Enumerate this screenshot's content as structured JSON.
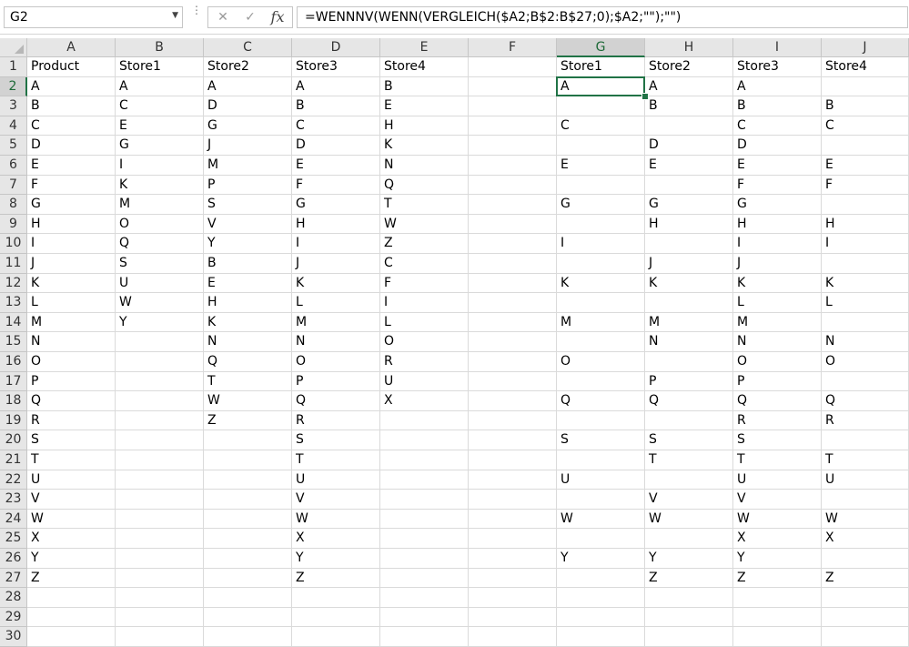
{
  "namebox": {
    "value": "G2"
  },
  "formula_bar": {
    "formula": "=WENNNV(WENN(VERGLEICH($A2;B$2:B$27;0);$A2;\"\");\"\")",
    "cancel_icon": "x-icon",
    "enter_icon": "checkmark-icon",
    "function_icon": "fx-icon"
  },
  "columns": [
    "A",
    "B",
    "C",
    "D",
    "E",
    "F",
    "G",
    "H",
    "I",
    "J"
  ],
  "rows": [
    "1",
    "2",
    "3",
    "4",
    "5",
    "6",
    "7",
    "8",
    "9",
    "10",
    "11",
    "12",
    "13",
    "14",
    "15",
    "16",
    "17",
    "18",
    "19",
    "20",
    "21",
    "22",
    "23",
    "24",
    "25",
    "26",
    "27",
    "28",
    "29",
    "30"
  ],
  "active_cell": {
    "col": "G",
    "row": "2"
  },
  "cells": [
    [
      "Product",
      "Store1",
      "Store2",
      "Store3",
      "Store4",
      "",
      "Store1",
      "Store2",
      "Store3",
      "Store4"
    ],
    [
      "A",
      "A",
      "A",
      "A",
      "B",
      "",
      "A",
      "A",
      "A",
      ""
    ],
    [
      "B",
      "C",
      "D",
      "B",
      "E",
      "",
      "",
      "B",
      "B",
      "B"
    ],
    [
      "C",
      "E",
      "G",
      "C",
      "H",
      "",
      "C",
      "",
      "C",
      "C"
    ],
    [
      "D",
      "G",
      "J",
      "D",
      "K",
      "",
      "",
      "D",
      "D",
      ""
    ],
    [
      "E",
      "I",
      "M",
      "E",
      "N",
      "",
      "E",
      "E",
      "E",
      "E"
    ],
    [
      "F",
      "K",
      "P",
      "F",
      "Q",
      "",
      "",
      "",
      "F",
      "F"
    ],
    [
      "G",
      "M",
      "S",
      "G",
      "T",
      "",
      "G",
      "G",
      "G",
      ""
    ],
    [
      "H",
      "O",
      "V",
      "H",
      "W",
      "",
      "",
      "H",
      "H",
      "H"
    ],
    [
      "I",
      "Q",
      "Y",
      "I",
      "Z",
      "",
      "I",
      "",
      "I",
      "I"
    ],
    [
      "J",
      "S",
      "B",
      "J",
      "C",
      "",
      "",
      "J",
      "J",
      ""
    ],
    [
      "K",
      "U",
      "E",
      "K",
      "F",
      "",
      "K",
      "K",
      "K",
      "K"
    ],
    [
      "L",
      "W",
      "H",
      "L",
      "I",
      "",
      "",
      "",
      "L",
      "L"
    ],
    [
      "M",
      "Y",
      "K",
      "M",
      "L",
      "",
      "M",
      "M",
      "M",
      ""
    ],
    [
      "N",
      "",
      "N",
      "N",
      "O",
      "",
      "",
      "N",
      "N",
      "N"
    ],
    [
      "O",
      "",
      "Q",
      "O",
      "R",
      "",
      "O",
      "",
      "O",
      "O"
    ],
    [
      "P",
      "",
      "T",
      "P",
      "U",
      "",
      "",
      "P",
      "P",
      ""
    ],
    [
      "Q",
      "",
      "W",
      "Q",
      "X",
      "",
      "Q",
      "Q",
      "Q",
      "Q"
    ],
    [
      "R",
      "",
      "Z",
      "R",
      "",
      "",
      "",
      "",
      "R",
      "R"
    ],
    [
      "S",
      "",
      "",
      "S",
      "",
      "",
      "S",
      "S",
      "S",
      ""
    ],
    [
      "T",
      "",
      "",
      "T",
      "",
      "",
      "",
      "T",
      "T",
      "T"
    ],
    [
      "U",
      "",
      "",
      "U",
      "",
      "",
      "U",
      "",
      "U",
      "U"
    ],
    [
      "V",
      "",
      "",
      "V",
      "",
      "",
      "",
      "V",
      "V",
      ""
    ],
    [
      "W",
      "",
      "",
      "W",
      "",
      "",
      "W",
      "W",
      "W",
      "W"
    ],
    [
      "X",
      "",
      "",
      "X",
      "",
      "",
      "",
      "",
      "X",
      "X"
    ],
    [
      "Y",
      "",
      "",
      "Y",
      "",
      "",
      "Y",
      "Y",
      "Y",
      ""
    ],
    [
      "Z",
      "",
      "",
      "Z",
      "",
      "",
      "",
      "Z",
      "Z",
      "Z"
    ],
    [
      "",
      "",
      "",
      "",
      "",
      "",
      "",
      "",
      "",
      ""
    ],
    [
      "",
      "",
      "",
      "",
      "",
      "",
      "",
      "",
      "",
      ""
    ],
    [
      "",
      "",
      "",
      "",
      "",
      "",
      "",
      "",
      "",
      ""
    ]
  ]
}
